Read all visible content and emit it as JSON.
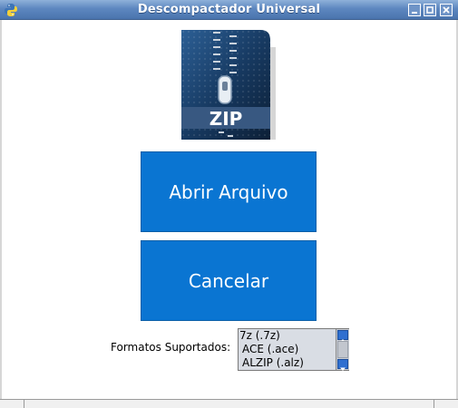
{
  "window": {
    "title": "Descompactador Universal",
    "app_icon": "python-icon",
    "controls": [
      "minimize-icon",
      "maximize-icon",
      "close-icon"
    ]
  },
  "logo": {
    "text": "ZIP",
    "icon": "zip-archive-icon"
  },
  "buttons": {
    "open_label": "Abrir Arquivo",
    "cancel_label": "Cancelar"
  },
  "formats": {
    "label": "Formatos Suportados:",
    "items": [
      "7z (.7z)",
      "ACE (.ace)",
      "ALZIP (.alz)"
    ]
  },
  "colors": {
    "accent": "#0a75d2",
    "titlebar": "#5d87c0",
    "listbox_bg": "#d9dde4"
  }
}
